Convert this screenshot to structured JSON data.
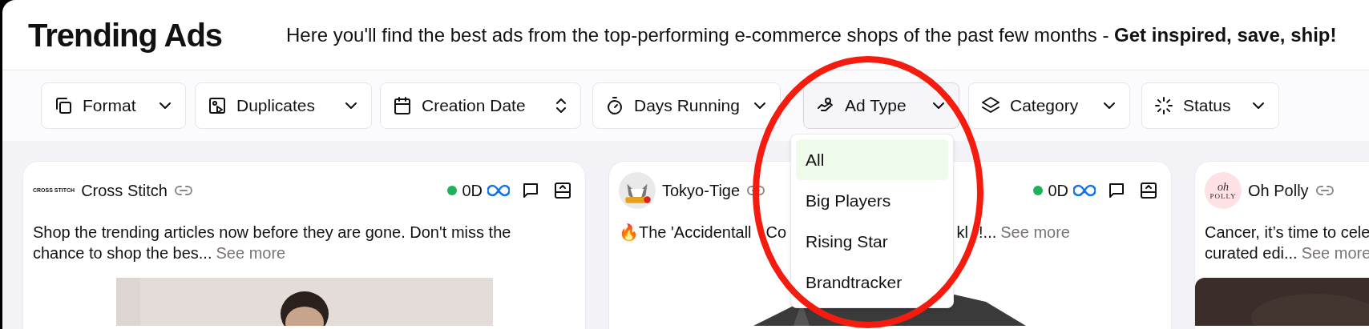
{
  "header": {
    "title": "Trending Ads",
    "tagline": "Here you'll find the best ads from the top-performing e-commerce shops of the past few months - **Get inspired, save, ship!**"
  },
  "filters": [
    {
      "label": "Format",
      "kind": "dropdown",
      "expanded": false
    },
    {
      "label": "Duplicates",
      "kind": "dropdown",
      "expanded": false
    },
    {
      "label": "Creation Date",
      "kind": "sort",
      "expanded": false
    },
    {
      "label": "Days Running",
      "kind": "dropdown",
      "expanded": false
    },
    {
      "label": "Ad Type",
      "kind": "dropdown",
      "expanded": true
    },
    {
      "label": "Category",
      "kind": "dropdown",
      "expanded": false
    },
    {
      "label": "Status",
      "kind": "dropdown",
      "expanded": false
    }
  ],
  "dropdown": {
    "items": [
      {
        "label": "All",
        "selected": true
      },
      {
        "label": "Big Players",
        "selected": false
      },
      {
        "label": "Rising Star",
        "selected": false
      },
      {
        "label": "Brandtracker",
        "selected": false
      }
    ]
  },
  "cards": [
    {
      "logo_lines": [
        "CROSS STITCH"
      ],
      "brand": "Cross Stitch",
      "meta": {
        "live": true,
        "age": "0D"
      },
      "lines": [
        "Shop the trending articles now before they are gone. Don't miss the",
        "chance to shop the bes..."
      ],
      "see_more": "See more"
    },
    {
      "brand": "Tokyo-Tige",
      "meta": {
        "live": true,
        "age": "0D"
      },
      "lines": [
        "🔥The 'Accidentall"
      ],
      "text_mid": "Co",
      "text_tail": "kl",
      "text_tail2": "!...",
      "see_more": "See more"
    },
    {
      "logo_lines": [
        "oh",
        "POLLY"
      ],
      "brand": "Oh Polly",
      "lines": [
        "Cancer, it’s time to cele",
        "curated edi..."
      ],
      "see_more": "See more"
    }
  ]
}
